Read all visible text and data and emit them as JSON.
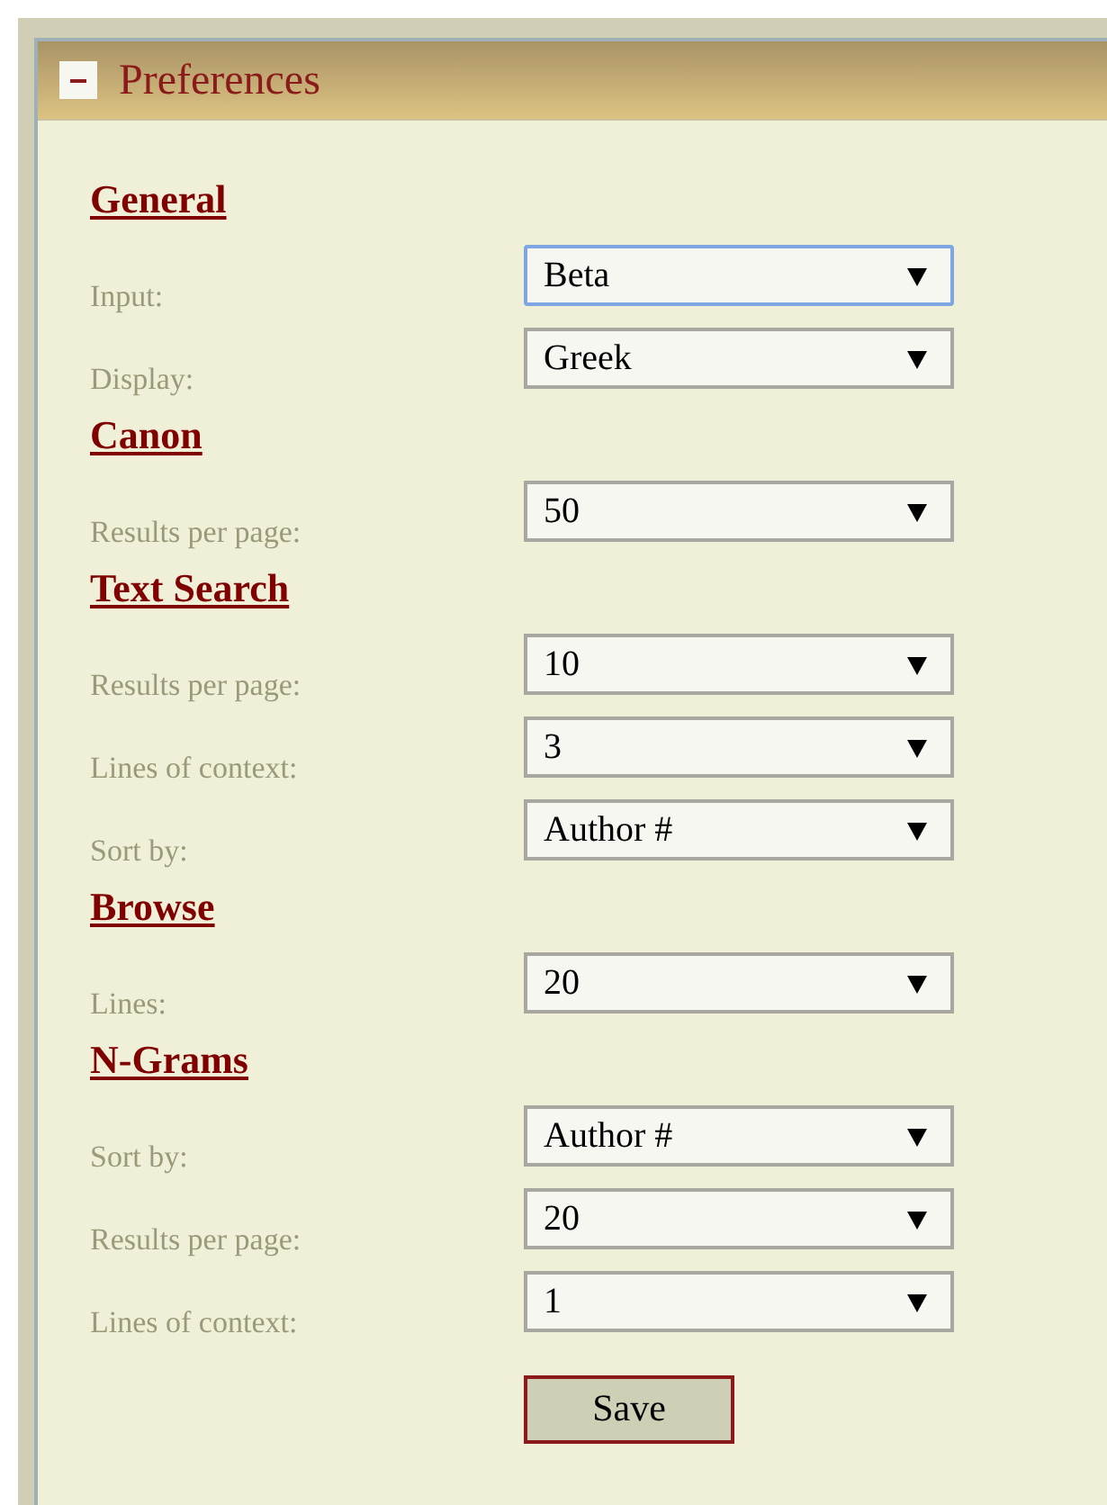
{
  "panel": {
    "title": "Preferences",
    "expanded": true
  },
  "sections": [
    {
      "heading": "General",
      "rows": [
        {
          "label": "Input:",
          "value": "Beta",
          "focused": true
        },
        {
          "label": "Display:",
          "value": "Greek",
          "focused": false
        }
      ]
    },
    {
      "heading": "Canon",
      "rows": [
        {
          "label": "Results per page:",
          "value": "50",
          "focused": false
        }
      ]
    },
    {
      "heading": "Text Search",
      "rows": [
        {
          "label": "Results per page:",
          "value": "10",
          "focused": false
        },
        {
          "label": "Lines of context:",
          "value": "3",
          "focused": false
        },
        {
          "label": "Sort by:",
          "value": "Author #",
          "focused": false
        }
      ]
    },
    {
      "heading": "Browse",
      "rows": [
        {
          "label": "Lines:",
          "value": "20",
          "focused": false
        }
      ]
    },
    {
      "heading": "N-Grams",
      "rows": [
        {
          "label": "Sort by:",
          "value": "Author #",
          "focused": false
        },
        {
          "label": "Results per page:",
          "value": "20",
          "focused": false
        },
        {
          "label": "Lines of context:",
          "value": "1",
          "focused": false
        }
      ]
    }
  ],
  "save_button": "Save"
}
